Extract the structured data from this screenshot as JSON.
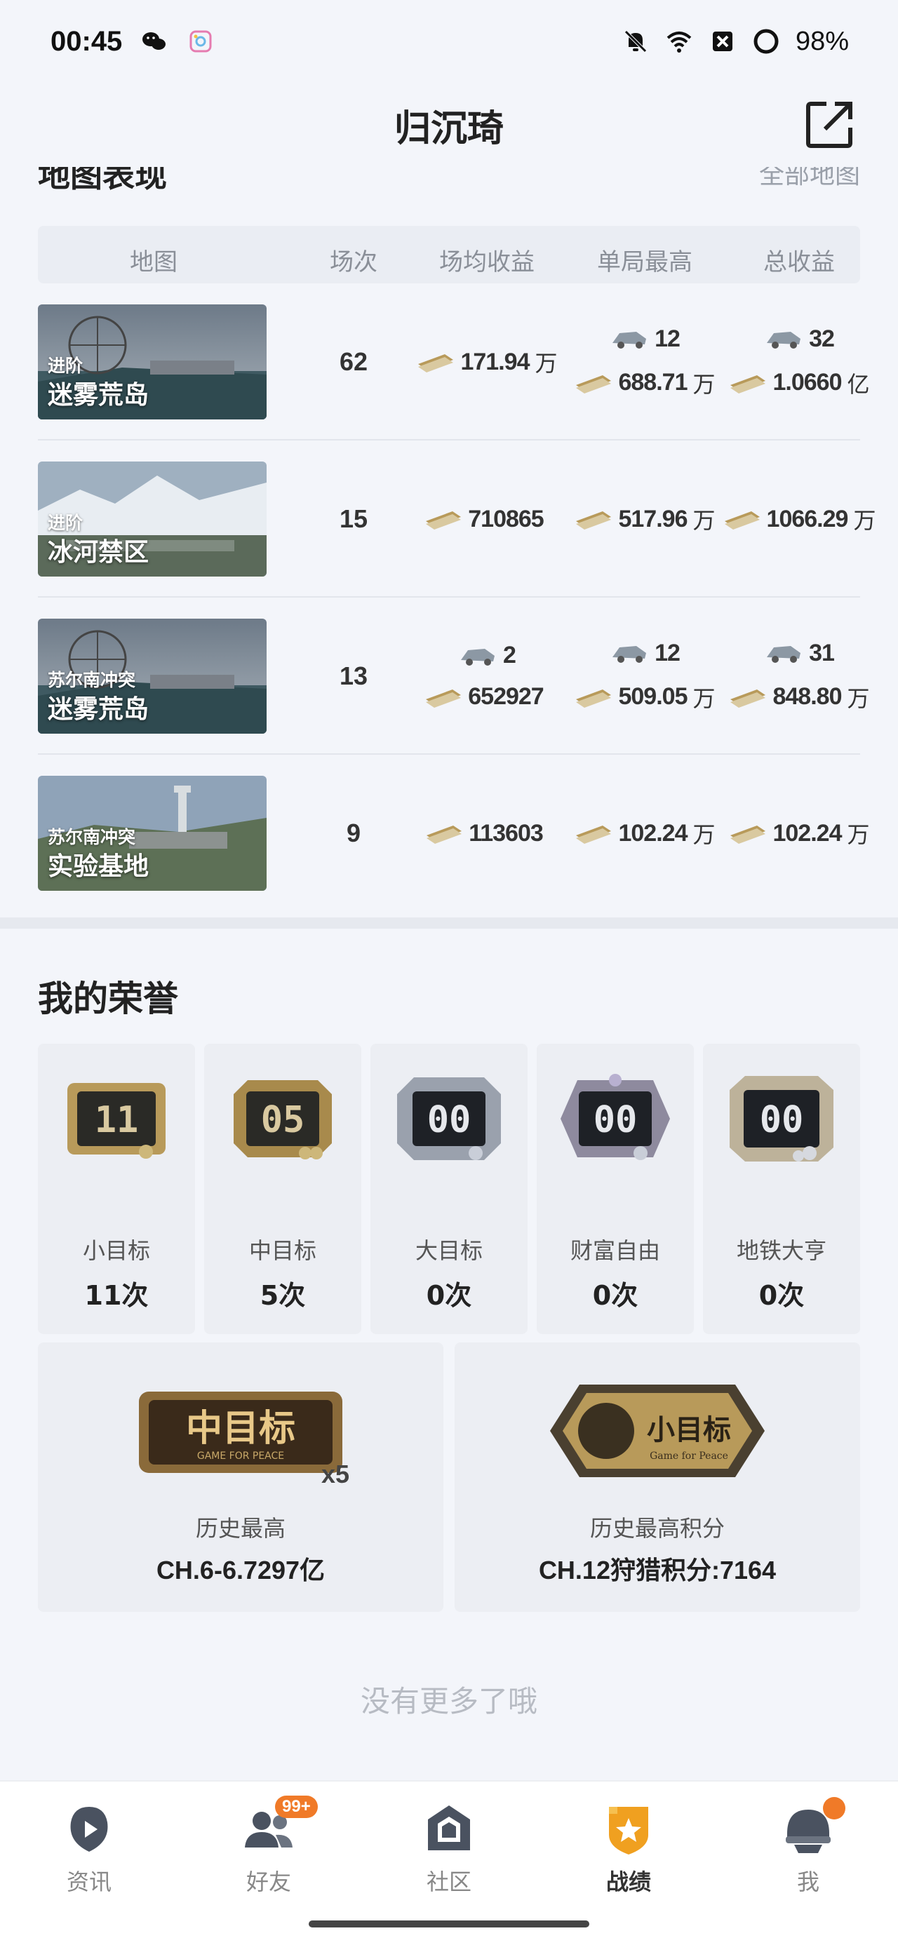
{
  "status_bar": {
    "time": "00:45",
    "battery": "98%",
    "icons": [
      "wechat-icon",
      "photo-app-icon",
      "mute-bell-icon",
      "wifi-icon",
      "sim-x-icon",
      "battery-ring-icon"
    ]
  },
  "header": {
    "title": "归沉琦",
    "share_icon": "share-external-icon"
  },
  "map_section": {
    "title": "地图表现",
    "all_maps_link": "全部地图",
    "columns": [
      "地图",
      "场次",
      "场均收益",
      "单局最高",
      "总收益"
    ],
    "rows": [
      {
        "mode": "进阶",
        "map": "迷雾荒岛",
        "matches": "62",
        "avg_car": "",
        "avg_cash": "171.94",
        "avg_unit": "万",
        "max_car": "12",
        "max_cash": "688.71",
        "max_unit": "万",
        "tot_car": "32",
        "tot_cash": "1.0660",
        "tot_unit": "亿"
      },
      {
        "mode": "进阶",
        "map": "冰河禁区",
        "matches": "15",
        "avg_car": "",
        "avg_cash": "710865",
        "avg_unit": "",
        "max_car": "",
        "max_cash": "517.96",
        "max_unit": "万",
        "tot_car": "",
        "tot_cash": "1066.29",
        "tot_unit": "万"
      },
      {
        "mode": "苏尔南冲突",
        "map": "迷雾荒岛",
        "matches": "13",
        "avg_car": "2",
        "avg_cash": "652927",
        "avg_unit": "",
        "max_car": "12",
        "max_cash": "509.05",
        "max_unit": "万",
        "tot_car": "31",
        "tot_cash": "848.80",
        "tot_unit": "万"
      },
      {
        "mode": "苏尔南冲突",
        "map": "实验基地",
        "matches": "9",
        "avg_car": "",
        "avg_cash": "113603",
        "avg_unit": "",
        "max_car": "",
        "max_cash": "102.24",
        "max_unit": "万",
        "tot_car": "",
        "tot_cash": "102.24",
        "tot_unit": "万"
      }
    ]
  },
  "honors": {
    "title": "我的荣誉",
    "badges": [
      {
        "plate": "11",
        "label": "小目标",
        "count": "11次"
      },
      {
        "plate": "05",
        "label": "中目标",
        "count": "5次"
      },
      {
        "plate": "00",
        "label": "大目标",
        "count": "0次"
      },
      {
        "plate": "00",
        "label": "财富自由",
        "count": "0次"
      },
      {
        "plate": "00",
        "label": "地铁大亨",
        "count": "0次"
      }
    ],
    "records": [
      {
        "emblem": "中目标",
        "emblem_sub": "GAME FOR PEACE",
        "multiplier": "x5",
        "label": "历史最高",
        "value": "CH.6-6.7297亿"
      },
      {
        "emblem": "小目标",
        "emblem_sub": "Game for Peace",
        "label": "历史最高积分",
        "value": "CH.12狩猎积分:7164"
      }
    ]
  },
  "footer_text": "没有更多了哦",
  "bottom_nav": [
    {
      "label": "资讯",
      "icon": "news-play-icon"
    },
    {
      "label": "好友",
      "icon": "friends-icon",
      "badge": "99+"
    },
    {
      "label": "社区",
      "icon": "community-house-icon"
    },
    {
      "label": "战绩",
      "icon": "record-shield-icon",
      "active": true
    },
    {
      "label": "我",
      "icon": "profile-helmet-icon",
      "dot": true
    }
  ],
  "colors": {
    "accent": "#f0a020",
    "badge": "#f07a28",
    "text": "#222222",
    "muted": "#8a8f98"
  }
}
